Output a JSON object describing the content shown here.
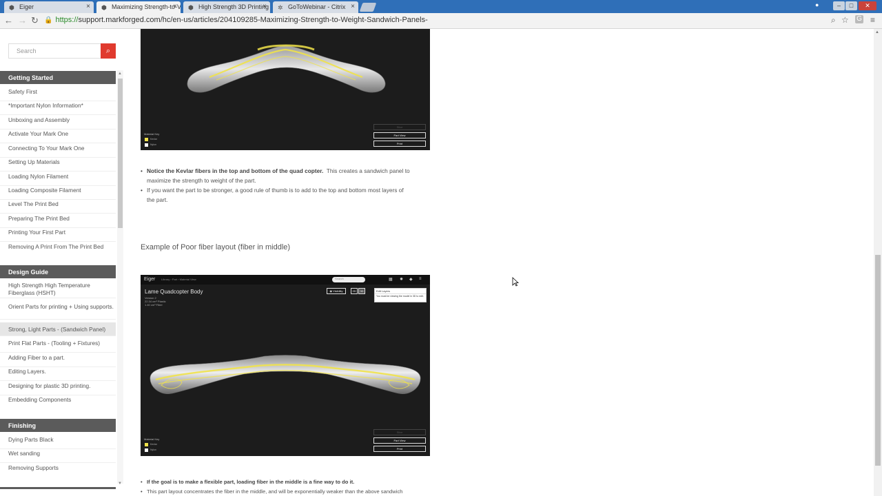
{
  "browser": {
    "tabs": [
      {
        "label": "Eiger",
        "icon": "markforged-logo-icon",
        "active": false
      },
      {
        "label": "Maximizing Strength-to-V",
        "icon": "markforged-logo-icon",
        "active": true
      },
      {
        "label": "High Strength 3D Printing",
        "icon": "markforged-logo-icon",
        "active": false
      },
      {
        "label": "GoToWebinar - Citrix",
        "icon": "gotowebinar-icon",
        "active": false
      }
    ],
    "url_scheme": "https://",
    "url_rest": "support.markforged.com/hc/en-us/articles/204109285-Maximizing-Strength-to-Weight-Sandwich-Panels-"
  },
  "sidebar": {
    "search_placeholder": "Search",
    "sections": [
      {
        "title": "Getting Started",
        "items": [
          "Safety First",
          "*Important Nylon Information*",
          "Unboxing and Assembly",
          "Activate Your Mark One",
          "Connecting To Your Mark One",
          "Setting Up Materials",
          "Loading Nylon Filament",
          "Loading Composite Filament",
          "Level The Print Bed",
          "Preparing The Print Bed",
          "Printing Your First Part",
          "Removing A Print From The Print Bed"
        ]
      },
      {
        "title": "Design Guide",
        "items": [
          "High Strength High Temperature Fiberglass (HSHT)",
          "Orient Parts for printing + Using supports.",
          "Strong, Light Parts - (Sandwich Panel)",
          "Print Flat Parts - (Tooling + Fixtures)",
          "Adding Fiber to a part.",
          "Editing Layers.",
          "Designing for plastic 3D printing.",
          "Embedding Components"
        ]
      },
      {
        "title": "Finishing",
        "items": [
          "Dying Parts Black",
          "Wet sanding",
          "Removing Supports"
        ]
      }
    ]
  },
  "content": {
    "shot1": {
      "key_title": "Material Key",
      "key_items": [
        "Kevlar",
        "Nylon"
      ],
      "buttons": [
        "Slice",
        "Part View",
        "Print"
      ]
    },
    "bullets1": {
      "b1_bold": "Notice the Kevlar fibers in the top and bottom of the quad copter.",
      "b1_rest_line1": "This creates a sandwich panel to",
      "b1_line2": "maximize the strength to weight of the part.",
      "b2_line1": "If you want the part to be stronger, a good rule of thumb is to add to the top and bottom most layers of",
      "b2_line2": "the part."
    },
    "heading": "Example of Poor fiber layout (fiber in middle)",
    "shot2": {
      "brand": "Eiger",
      "breadcrumb": "Library  ›  Part  ›  Material View",
      "search": "Search",
      "title": "Lame Quadcopter Body",
      "meta": [
        "Version 2",
        "22.34 cm³ Plastic",
        "1.40 cm³ Fiber"
      ],
      "visibility_btn": "Visibility",
      "view_2d": "2D",
      "view_3d": "3D",
      "panel_head": "Edit Layers",
      "panel_body": "You must be viewing the model in 3D to edit.",
      "key_title": "Material Key",
      "key_items": [
        "Kevlar",
        "Nylon"
      ],
      "buttons": [
        "Slice",
        "Part View",
        "Print"
      ]
    },
    "bullets2": {
      "b1": "If the goal is to make a flexible part, loading fiber in the middle is a fine way to do it.",
      "b2": "This part layout concentrates the fiber in the middle, and will be exponentially weaker than the above sandwich"
    }
  },
  "colors": {
    "tabbar": "#2f6fb8",
    "search_button": "#e03a2e",
    "section_header": "#5b5b5b",
    "kevlar": "#f0e24a"
  }
}
